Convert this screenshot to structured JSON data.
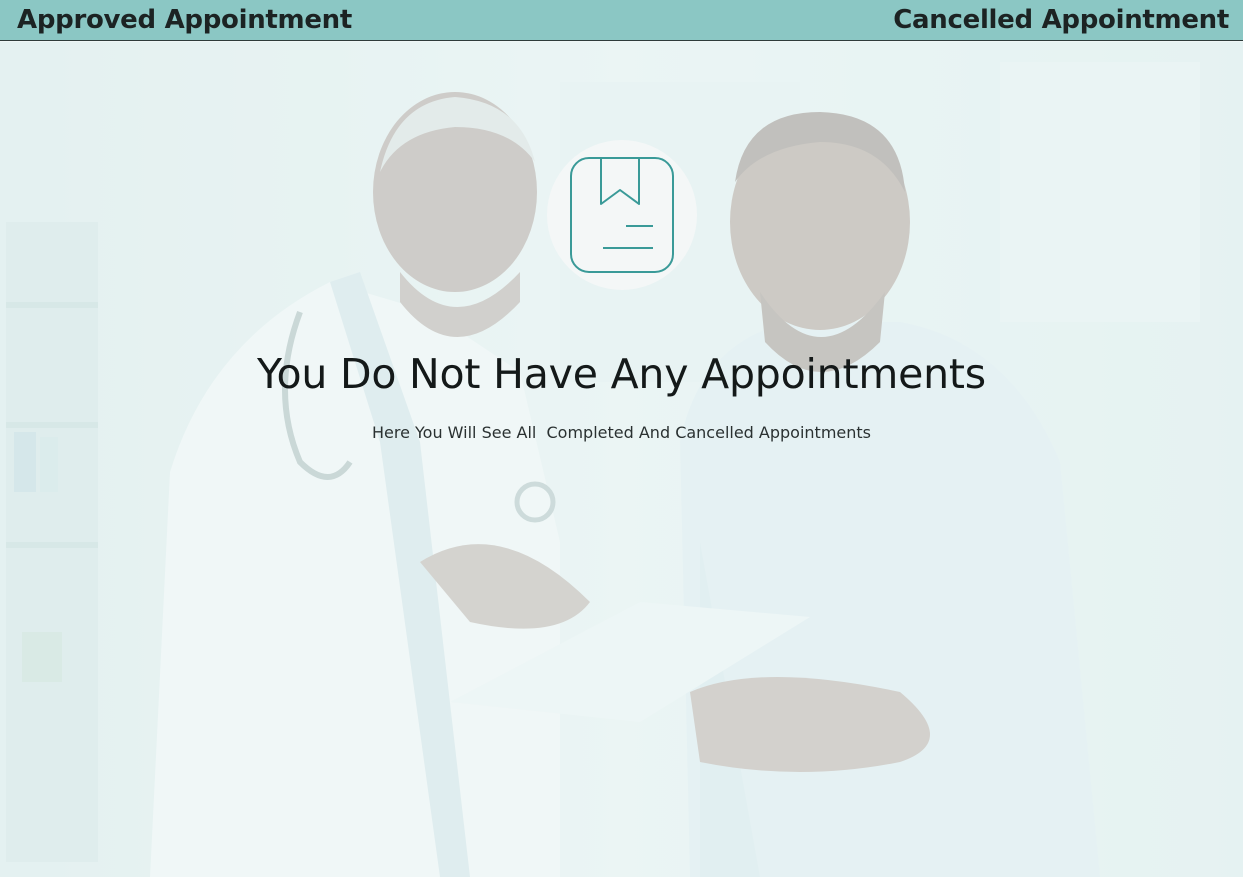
{
  "tabs": {
    "approved_label": "Approved Appointment",
    "cancelled_label": "Cancelled Appointment"
  },
  "empty_state": {
    "icon": "bookmark-document-icon",
    "title": "You Do Not Have Any Appointments",
    "subtitle": "Here You Will See All  Completed And Cancelled Appointments"
  },
  "colors": {
    "tab_bar": "#8bc7c4",
    "accent": "#3a9a98",
    "page_background": "#eef6f6"
  }
}
